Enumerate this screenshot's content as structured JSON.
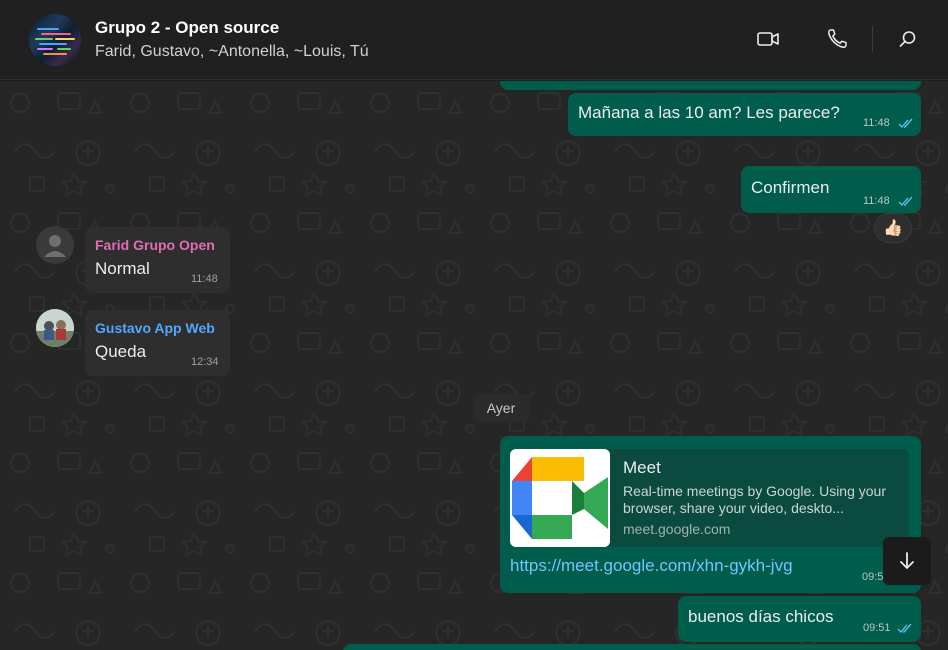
{
  "header": {
    "title": "Grupo 2 - Open source",
    "members": "Farid, Gustavo, ~Antonella, ~Louis, Tú",
    "video_icon": "video-camera-icon",
    "call_icon": "phone-icon",
    "search_icon": "search-icon"
  },
  "messages": {
    "m1": {
      "text": "Mañana a las 10 am? Les parece?",
      "time": "11:48",
      "reaction": "👍🏻"
    },
    "m2": {
      "text": "Confirmen",
      "time": "11:48"
    },
    "m3": {
      "sender": "Farid Grupo Open",
      "sender_color": "#e26ab6",
      "text": "Normal",
      "time": "11:48"
    },
    "m4": {
      "sender": "Gustavo App Web",
      "sender_color": "#53a6fd",
      "text": "Queda",
      "time": "12:34"
    },
    "date_separator": "Ayer",
    "m5": {
      "preview_title": "Meet",
      "preview_description": "Real-time meetings by Google. Using your browser, share your video, deskto...",
      "preview_domain": "meet.google.com",
      "link": "https://meet.google.com/xhn-gykh-jvg",
      "time": "09:5"
    },
    "m6": {
      "text": "buenos días chicos",
      "time": "09:51"
    }
  },
  "colors": {
    "outgoing_bubble": "#005c4b",
    "incoming_bubble": "#2e2e2e",
    "read_ticks": "#53bdeb",
    "link": "#6ec6ff"
  }
}
